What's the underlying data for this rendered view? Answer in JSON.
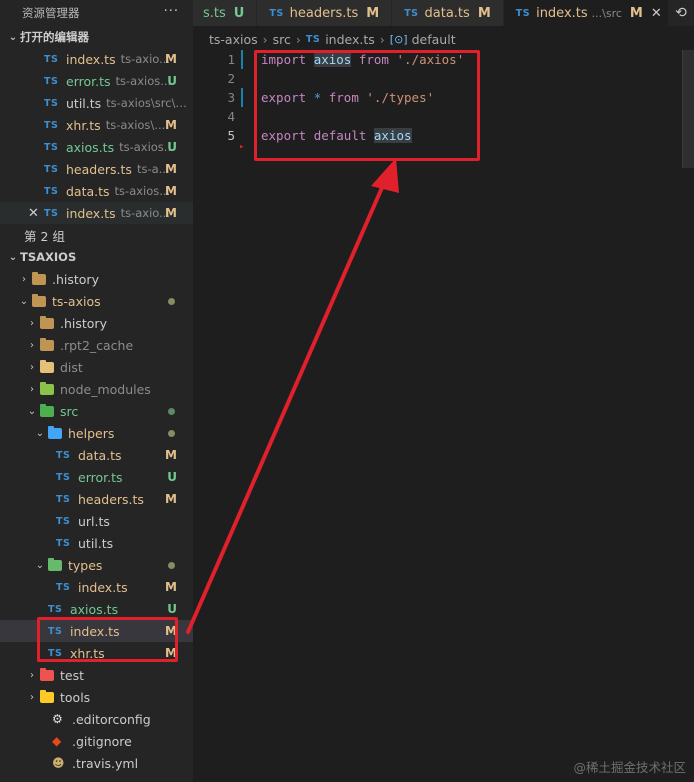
{
  "sidebar": {
    "title": "资源管理器",
    "more": "···",
    "open_editors_title": "打开的编辑器",
    "open_editors": [
      {
        "name": "index.ts",
        "desc": "ts-axio...",
        "badge": "M",
        "status": "modified"
      },
      {
        "name": "error.ts",
        "desc": "ts-axios...",
        "badge": "U",
        "status": "untracked"
      },
      {
        "name": "util.ts",
        "desc": "ts-axios\\src\\hel...",
        "badge": "",
        "status": "normal"
      },
      {
        "name": "xhr.ts",
        "desc": "ts-axios\\...",
        "badge": "M",
        "status": "modified"
      },
      {
        "name": "axios.ts",
        "desc": "ts-axios...",
        "badge": "U",
        "status": "untracked"
      },
      {
        "name": "headers.ts",
        "desc": "ts-a...",
        "badge": "M",
        "status": "modified"
      },
      {
        "name": "data.ts",
        "desc": "ts-axios...",
        "badge": "M",
        "status": "modified"
      },
      {
        "name": "index.ts",
        "desc": "ts-axio...",
        "badge": "M",
        "status": "modified",
        "active": true
      }
    ],
    "group2": "第 2 组",
    "project_title": "TSAXIOS",
    "tree": [
      {
        "name": ".history",
        "indent": 1,
        "type": "folder",
        "chev": "›",
        "color": "#c09553"
      },
      {
        "name": "ts-axios",
        "indent": 1,
        "type": "folder",
        "chev": "⌄",
        "color": "#c09553",
        "dot": "yellow",
        "status": "modified"
      },
      {
        "name": ".history",
        "indent": 2,
        "type": "folder",
        "chev": "›",
        "color": "#c09553"
      },
      {
        "name": ".rpt2_cache",
        "indent": 2,
        "type": "folder",
        "chev": "›",
        "color": "#c09553",
        "dim": true
      },
      {
        "name": "dist",
        "indent": 2,
        "type": "folder",
        "chev": "›",
        "color": "#e5c07b",
        "dim": true
      },
      {
        "name": "node_modules",
        "indent": 2,
        "type": "folder",
        "chev": "›",
        "color": "#8bc34a",
        "dim": true
      },
      {
        "name": "src",
        "indent": 2,
        "type": "folder",
        "chev": "⌄",
        "color": "#4caf50",
        "dot": "green",
        "status": "untracked"
      },
      {
        "name": "helpers",
        "indent": 3,
        "type": "folder",
        "chev": "⌄",
        "color": "#42a5f5",
        "dot": "yellow",
        "status": "modified"
      },
      {
        "name": "data.ts",
        "indent": 4,
        "type": "ts",
        "badge": "M",
        "status": "modified"
      },
      {
        "name": "error.ts",
        "indent": 4,
        "type": "ts",
        "badge": "U",
        "status": "untracked"
      },
      {
        "name": "headers.ts",
        "indent": 4,
        "type": "ts",
        "badge": "M",
        "status": "modified"
      },
      {
        "name": "url.ts",
        "indent": 4,
        "type": "ts",
        "badge": "",
        "status": "normal"
      },
      {
        "name": "util.ts",
        "indent": 4,
        "type": "ts",
        "badge": "",
        "status": "normal"
      },
      {
        "name": "types",
        "indent": 3,
        "type": "folder",
        "chev": "⌄",
        "color": "#66bb6a",
        "dot": "yellow",
        "status": "modified"
      },
      {
        "name": "index.ts",
        "indent": 4,
        "type": "ts",
        "badge": "M",
        "status": "modified"
      },
      {
        "name": "axios.ts",
        "indent": 3,
        "type": "ts",
        "badge": "U",
        "status": "untracked"
      },
      {
        "name": "index.ts",
        "indent": 3,
        "type": "ts",
        "badge": "M",
        "status": "modified",
        "selected": true
      },
      {
        "name": "xhr.ts",
        "indent": 3,
        "type": "ts",
        "badge": "M",
        "status": "modified"
      },
      {
        "name": "test",
        "indent": 2,
        "type": "folder",
        "chev": "›",
        "color": "#ef5350"
      },
      {
        "name": "tools",
        "indent": 2,
        "type": "folder",
        "chev": "›",
        "color": "#ffca28"
      },
      {
        "name": ".editorconfig",
        "indent": 2,
        "type": "file",
        "icon": "⚙",
        "iconColor": "#e0e0e0"
      },
      {
        "name": ".gitignore",
        "indent": 2,
        "type": "file",
        "icon": "◆",
        "iconColor": "#e64a19"
      },
      {
        "name": ".travis.yml",
        "indent": 2,
        "type": "file",
        "icon": "☻",
        "iconColor": "#cbb06d"
      }
    ]
  },
  "tabs": [
    {
      "name": "s.ts",
      "badge": "U",
      "status": "untracked",
      "partial": true
    },
    {
      "name": "headers.ts",
      "badge": "M",
      "status": "modified"
    },
    {
      "name": "data.ts",
      "badge": "M",
      "status": "modified"
    },
    {
      "name": "index.ts",
      "desc": "...\\src",
      "badge": "M",
      "status": "modified",
      "active": true
    }
  ],
  "ts_label": "TS",
  "breadcrumb": [
    "ts-axios",
    "src",
    "index.ts",
    "default"
  ],
  "editor": {
    "line_numbers": [
      "1",
      "2",
      "3",
      "4",
      "5"
    ],
    "line1": {
      "kw": "import",
      "id": "axios",
      "kw2": "from",
      "str": "'./axios'"
    },
    "line3": {
      "kw": "export",
      "star": "*",
      "kw2": "from",
      "str": "'./types'"
    },
    "line5": {
      "kw": "export",
      "kw2": "default",
      "id": "axios"
    }
  },
  "watermark": "@稀土掘金技术社区",
  "colors": {
    "annotation": "#e0202a",
    "modified": "#e2c08d",
    "untracked": "#73c991",
    "ts_icon": "#3d8fd1"
  }
}
